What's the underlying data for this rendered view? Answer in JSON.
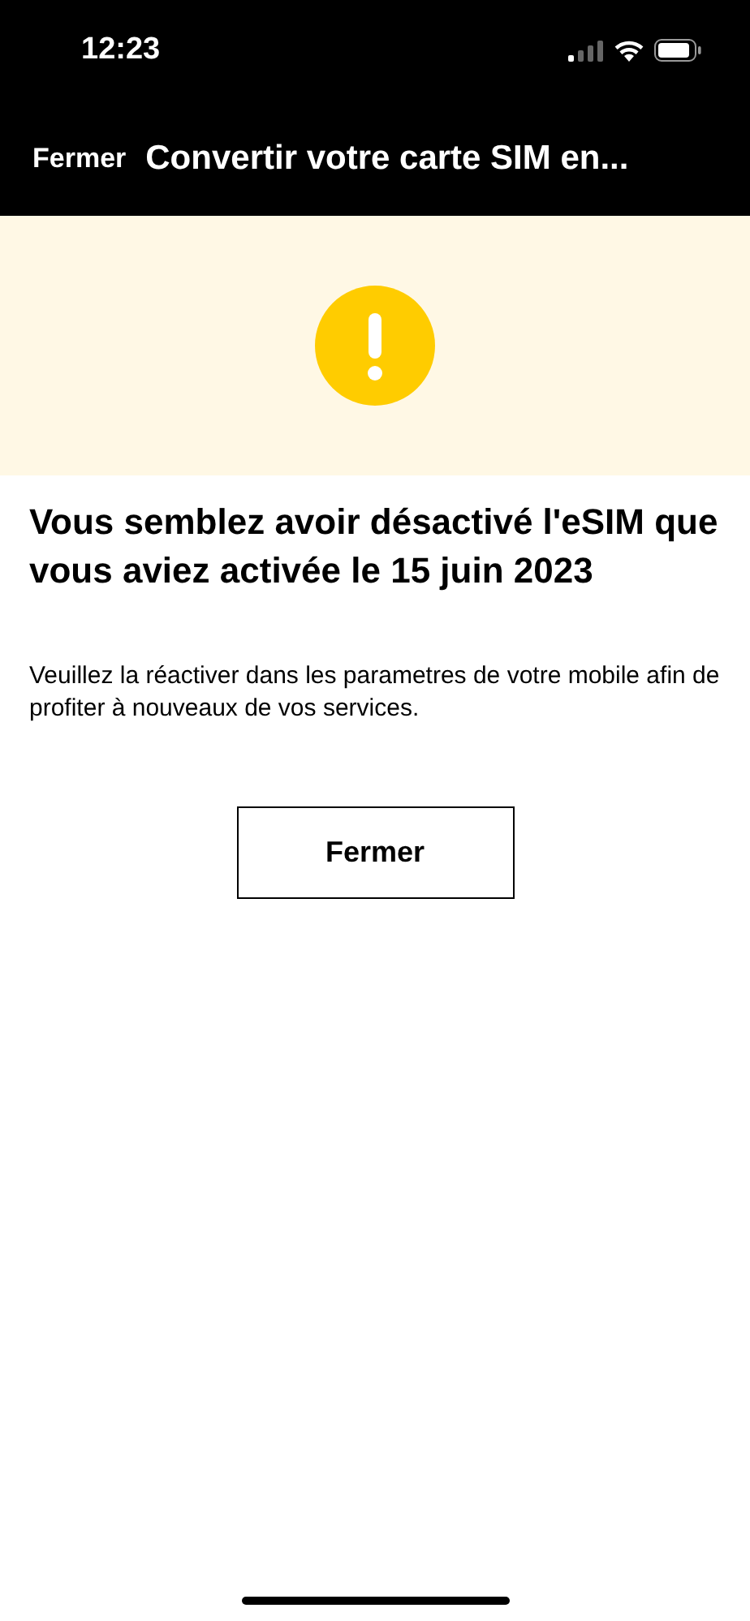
{
  "status_bar": {
    "time": "12:23"
  },
  "nav_bar": {
    "close": "Fermer",
    "title": "Convertir votre carte SIM en..."
  },
  "message": {
    "title": "Vous semblez avoir désactivé l'eSIM que vous aviez activée le 15 juin 2023",
    "body": "Veuillez la réactiver dans les parametres de votre mobile afin de profiter à nouveaux de vos services."
  },
  "buttons": [
    "Fermer"
  ]
}
